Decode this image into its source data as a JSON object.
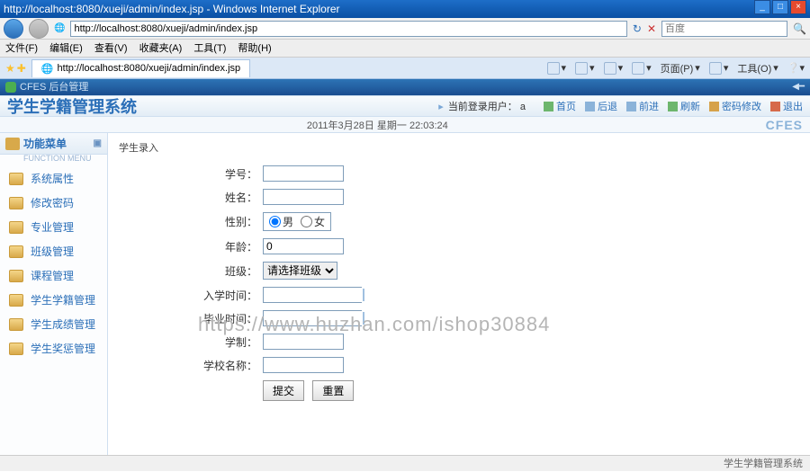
{
  "window": {
    "title": "http://localhost:8080/xueji/admin/index.jsp - Windows Internet Explorer"
  },
  "address": {
    "url": "http://localhost:8080/xueji/admin/index.jsp",
    "search_placeholder": "百度"
  },
  "menu": {
    "file": "文件(F)",
    "edit": "编辑(E)",
    "view": "查看(V)",
    "favorites": "收藏夹(A)",
    "tools": "工具(T)",
    "help": "帮助(H)"
  },
  "tab": {
    "title": "http://localhost:8080/xueji/admin/index.jsp"
  },
  "ie_tools": {
    "home": "",
    "page": "页面(P)",
    "safety": "",
    "tools": "工具(O)"
  },
  "app": {
    "small_title": "CFES 后台管理",
    "logo": "学生学籍管理系统",
    "current_user_label": "当前登录用户：",
    "current_user": "a",
    "date": "2011年3月28日 星期一 22:03:24",
    "cfes": "CFES"
  },
  "topnav": {
    "home": "首页",
    "back": "后退",
    "forward": "前进",
    "refresh": "刷新",
    "changepw": "密码修改",
    "logout": "退出"
  },
  "sidebar": {
    "title": "功能菜单",
    "sub": "FUNCTION MENU",
    "items": [
      {
        "label": "系统属性"
      },
      {
        "label": "修改密码"
      },
      {
        "label": "专业管理"
      },
      {
        "label": "班级管理"
      },
      {
        "label": "课程管理"
      },
      {
        "label": "学生学籍管理"
      },
      {
        "label": "学生成绩管理"
      },
      {
        "label": "学生奖惩管理"
      }
    ]
  },
  "form": {
    "title": "学生录入",
    "labels": {
      "sno": "学号：",
      "name": "姓名：",
      "gender": "性别：",
      "male": "男",
      "female": "女",
      "age": "年龄：",
      "age_value": "0",
      "class": "班级：",
      "class_option": "请选择班级",
      "enroll": "入学时间：",
      "graduate": "毕业时间：",
      "years": "学制：",
      "school": "学校名称："
    },
    "buttons": {
      "submit": "提交",
      "reset": "重置"
    }
  },
  "watermark": "https://www.huzhan.com/ishop30884",
  "status": "学生学籍管理系统"
}
